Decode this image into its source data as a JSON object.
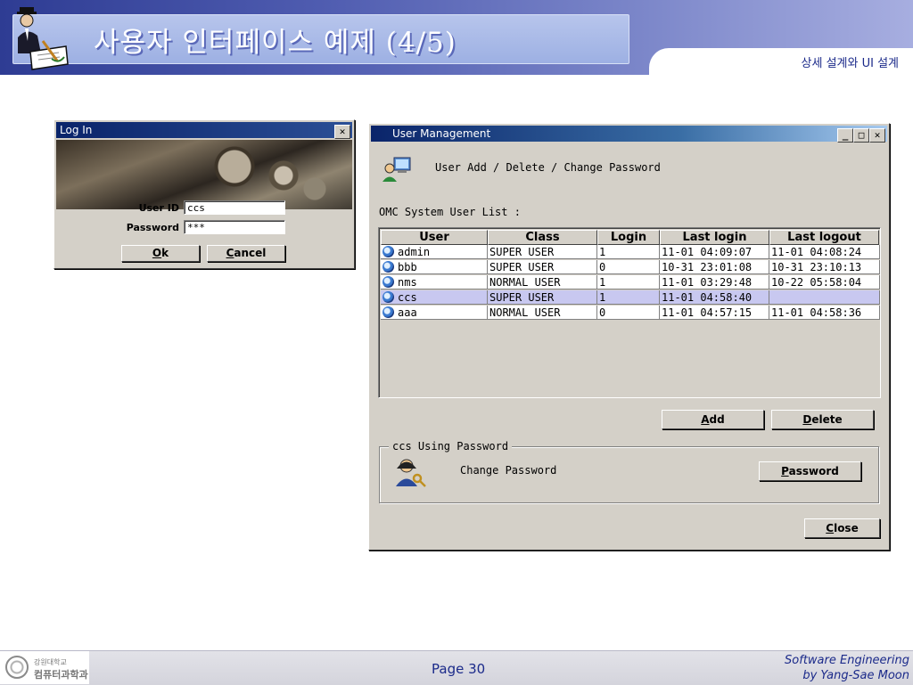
{
  "slide": {
    "title": "사용자 인터페이스 예제 (4/5)",
    "subtitle": "상세 설계와 UI 설계",
    "page": "Page 30",
    "credit_line1": "Software Engineering",
    "credit_line2": "by Yang-Sae Moon",
    "university_line": "강원대학교",
    "department_line": "컴퓨터과학과",
    "header_icon": "writer-at-desk-icon",
    "logo_icon": "university-seal-icon"
  },
  "login_window": {
    "title": "Log In",
    "close_glyph": "✕",
    "user_id_label": "User ID",
    "user_id_value": "ccs",
    "password_label": "Password",
    "password_value": "***",
    "ok_prefix": "",
    "ok_mnemonic": "O",
    "ok_rest": "k",
    "cancel_mnemonic": "C",
    "cancel_rest": "ancel"
  },
  "user_management": {
    "title": "User Management",
    "minimize_glyph": "_",
    "maximize_glyph": "□",
    "close_glyph": "✕",
    "header_text": "User Add / Delete / Change Password",
    "list_label": "OMC System User List :",
    "columns": [
      "User",
      "Class",
      "Login",
      "Last login",
      "Last logout"
    ],
    "rows": [
      {
        "user": "admin",
        "class": "SUPER USER",
        "login": "1",
        "last_login": "11-01 04:09:07",
        "last_logout": "11-01 04:08:24"
      },
      {
        "user": "bbb",
        "class": "SUPER USER",
        "login": "0",
        "last_login": "10-31 23:01:08",
        "last_logout": "10-31 23:10:13"
      },
      {
        "user": "nms",
        "class": "NORMAL USER",
        "login": "1",
        "last_login": "11-01 03:29:48",
        "last_logout": "10-22 05:58:04"
      },
      {
        "user": "ccs",
        "class": "SUPER USER",
        "login": "1",
        "last_login": "11-01 04:58:40",
        "last_logout": ""
      },
      {
        "user": "aaa",
        "class": "NORMAL USER",
        "login": "0",
        "last_login": "11-01 04:57:15",
        "last_logout": "11-01 04:58:36"
      }
    ],
    "selected_row": 3,
    "add_mnemonic": "A",
    "add_rest": "dd",
    "delete_mnemonic": "D",
    "delete_rest": "elete",
    "group_legend": "ccs  Using Password",
    "change_password_text": "Change Password",
    "password_mnemonic": "P",
    "password_rest": "assword",
    "close_mnemonic": "C",
    "close_rest": "lose",
    "header_icon": "users-computer-icon",
    "group_icon": "user-key-icon",
    "row_icon": "user-globe-icon"
  },
  "colors": {
    "titlebar": "#0a246a",
    "window_face": "#d4d0c8",
    "selected_row": "#c8c8f0",
    "slide_blue": "#1b2a8a"
  }
}
